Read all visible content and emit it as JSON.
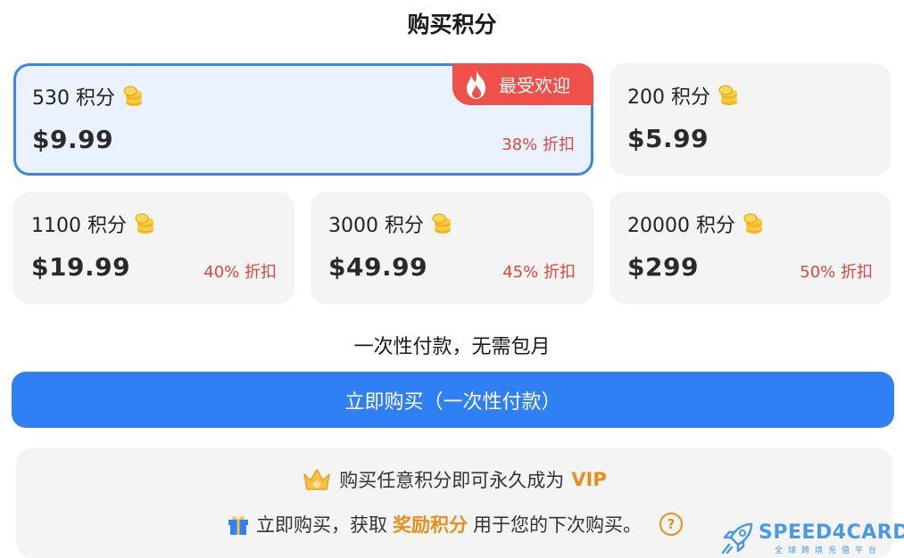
{
  "title": "购买积分",
  "packages": [
    {
      "credits": "530 积分",
      "price": "$9.99",
      "discount": "38% 折扣",
      "badge": "最受欢迎"
    },
    {
      "credits": "200 积分",
      "price": "$5.99",
      "discount": ""
    },
    {
      "credits": "1100 积分",
      "price": "$19.99",
      "discount": "40% 折扣"
    },
    {
      "credits": "3000 积分",
      "price": "$49.99",
      "discount": "45% 折扣"
    },
    {
      "credits": "20000 积分",
      "price": "$299",
      "discount": "50% 折扣"
    }
  ],
  "note": "一次性付款，无需包月",
  "buy_button": "立即购买（一次性付款）",
  "info": {
    "vip_text": "购买任意积分即可永久成为",
    "vip_word": "VIP",
    "reward_prefix": "立即购买，获取",
    "reward_word": "奖励积分",
    "reward_suffix": "用于您的下次购买。",
    "help_symbol": "?"
  },
  "watermark": {
    "name": "SPEED4CARD",
    "tagline": "全球跨境充值平台"
  },
  "colors": {
    "accent": "#2f7ff5",
    "selected_border": "#3b86e6",
    "discount": "#e0483d",
    "badge": "#f0504a",
    "vip": "#e8901e"
  }
}
